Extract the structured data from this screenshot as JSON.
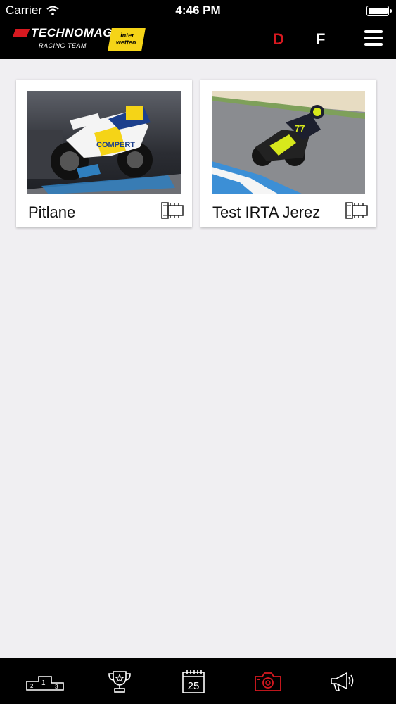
{
  "status": {
    "carrier": "Carrier",
    "time": "4:46 PM",
    "battery_level": 0.95
  },
  "header": {
    "brand": "TECHNOMAG",
    "subtitle": "RACING TEAM",
    "sponsor_line1": "inter",
    "sponsor_line2": "wetten",
    "lang_d": "D",
    "lang_f": "F"
  },
  "galleries": [
    {
      "title": "Pitlane",
      "image": "motorcycle-on-stand-photo"
    },
    {
      "title": "Test IRTA Jerez",
      "image": "rider-on-track-photo"
    }
  ],
  "tabbar": {
    "active_tab": "photos",
    "podium": {
      "l1": "1",
      "l2": "2",
      "l3": "3"
    },
    "calendar_day": "25",
    "tabs": [
      "podium-icon",
      "trophy-icon",
      "calendar-icon",
      "camera-icon",
      "megaphone-icon"
    ]
  },
  "colors": {
    "accent": "#d71920",
    "bar": "#000000",
    "background": "#f0eff2",
    "sponsor": "#f5d417"
  }
}
